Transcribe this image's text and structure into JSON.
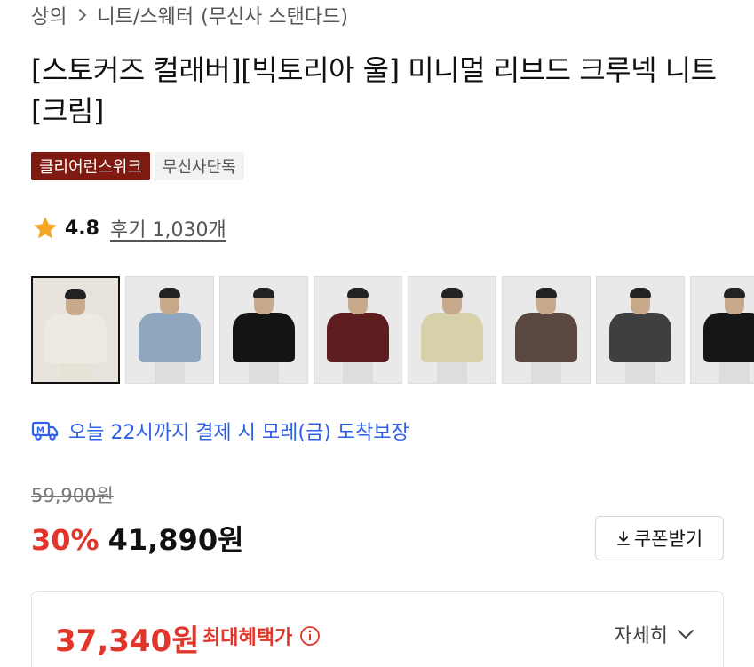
{
  "breadcrumb": {
    "category": "상의",
    "subcategory": "니트/스웨터",
    "store": "(무신사 스탠다드)"
  },
  "product": {
    "title": "[스토커즈 컬래버][빅토리아 울] 미니멀 리브드 크루넥 니트 [크림]"
  },
  "badges": [
    {
      "label": "클리어런스위크"
    },
    {
      "label": "무신사단독"
    }
  ],
  "rating": {
    "score": "4.8",
    "reviews": "후기 1,030개"
  },
  "thumbnails": [
    {
      "color_name": "cream",
      "sweater": "#eceae2",
      "bg": "#e8e3dc"
    },
    {
      "color_name": "sky-blue",
      "sweater": "#8fa6bf",
      "bg": "#e9e9e9"
    },
    {
      "color_name": "black",
      "sweater": "#141414",
      "bg": "#e9e9e9"
    },
    {
      "color_name": "burgundy",
      "sweater": "#5e1d20",
      "bg": "#e9e9e9"
    },
    {
      "color_name": "beige",
      "sweater": "#d7d1aa",
      "bg": "#e9e9e9"
    },
    {
      "color_name": "brown",
      "sweater": "#5a4840",
      "bg": "#e9e9e9"
    },
    {
      "color_name": "charcoal",
      "sweater": "#3e3f40",
      "bg": "#e9e9e9"
    },
    {
      "color_name": "black",
      "sweater": "#161616",
      "bg": "#e9e9e9"
    }
  ],
  "delivery": {
    "text": "오늘 22시까지 결제 시 모레(금) 도착보장"
  },
  "pricing": {
    "original": "59,900원",
    "discount": "30%",
    "sale": "41,890원",
    "coupon_label": "쿠폰받기",
    "max_benefit_price": "37,340원",
    "max_benefit_label": "최대혜택가",
    "detail_label": "자세히"
  },
  "colors": {
    "accent_red": "#e2362a",
    "badge_red": "#7f1a12",
    "delivery_blue": "#2f5fe8",
    "star": "#f5a623"
  }
}
